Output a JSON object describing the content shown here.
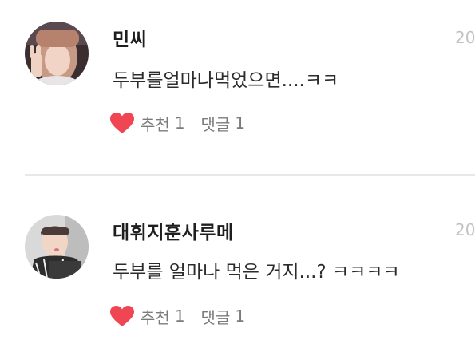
{
  "comments": [
    {
      "username": "민씨",
      "date": "20",
      "text": "두부를얼마나먹었으면....ㅋㅋ",
      "like_icon": "heart-icon",
      "like_label": "추천",
      "like_count": "1",
      "reply_label": "댓글",
      "reply_count": "1"
    },
    {
      "username": "대휘지훈사루메",
      "date": "20",
      "text": "두부를 얼마나 먹은 거지...? ㅋㅋㅋㅋ",
      "like_icon": "heart-icon",
      "like_label": "추천",
      "like_count": "1",
      "reply_label": "댓글",
      "reply_count": "1"
    }
  ],
  "colors": {
    "heart": "#f04552",
    "username": "#1e1e1e",
    "date": "#c2c2c2",
    "meta": "#7b7b7b",
    "divider": "#e8e8e8"
  }
}
